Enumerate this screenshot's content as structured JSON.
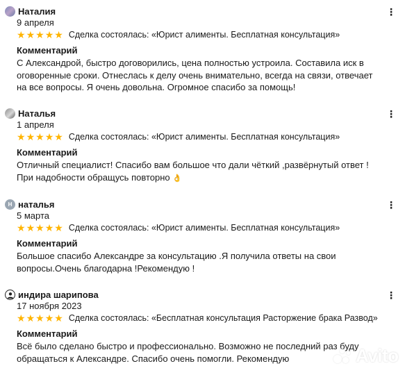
{
  "reviews": [
    {
      "name": "Наталия",
      "date": "9 апреля",
      "rating": 5,
      "deal": "Сделка состоялась: «Юрист алименты. Бесплатная консультация»",
      "comment_label": "Комментарий",
      "comment": "С Александрой, быстро договорились, цена полностью устроила. Составила иск в оговоренные сроки. Отнеслась к делу очень внимательно, всегда на связи, отвечает на все вопросы. Я очень довольна. Огромное спасибо за помощь!"
    },
    {
      "name": "Наталья",
      "date": "1 апреля",
      "rating": 5,
      "deal": "Сделка состоялась: «Юрист алименты. Бесплатная консультация»",
      "comment_label": "Комментарий",
      "comment": "Отличный специалист! Спасибо вам большое что дали чёткий ,развёрнутый ответ ! При надобности обращусь повторно",
      "emoji": "👌"
    },
    {
      "name": "наталья",
      "avatar_initial": "Н",
      "date": "5 марта",
      "rating": 5,
      "deal": "Сделка состоялась: «Юрист алименты. Бесплатная консультация»",
      "comment_label": "Комментарий",
      "comment": "Большое спасибо Александре за консультацию .Я получила ответы на свои вопросы.Очень благодарна !Рекомендую !"
    },
    {
      "name": "индира шарипова",
      "date": "17 ноября 2023",
      "rating": 5,
      "deal": "Сделка состоялась: «Бесплатная консультация Расторжение брака Развод»",
      "comment_label": "Комментарий",
      "comment": "Всё было сделано быстро и профессионально. Возможно не последний раз буду обращаться к Александре. Спасибо очень помогли. Рекомендую"
    }
  ],
  "icons": {
    "star": "★",
    "more": "⋮",
    "star_color": "#ffb400"
  },
  "watermark": {
    "text": "Avito"
  }
}
